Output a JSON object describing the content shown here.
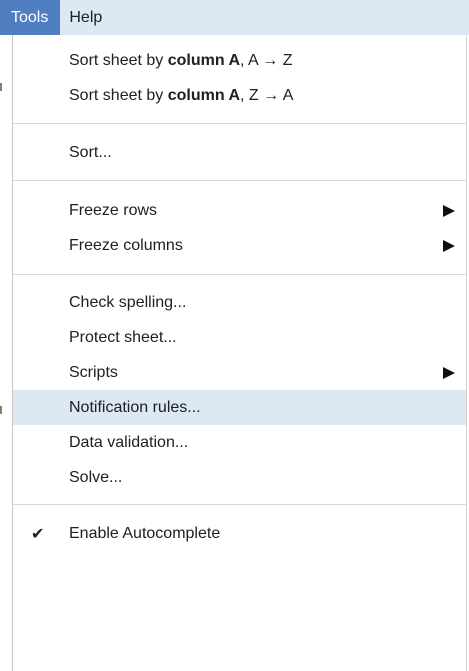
{
  "menubar": {
    "tools_label": "Tools",
    "help_label": "Help"
  },
  "menu": {
    "sort_az": {
      "prefix": "Sort sheet by ",
      "bold": "column A",
      "suffix": ", A → Z"
    },
    "sort_za": {
      "prefix": "Sort sheet by ",
      "bold": "column A",
      "suffix": ", Z → A"
    },
    "sort_label": "Sort...",
    "freeze_rows_label": "Freeze rows",
    "freeze_columns_label": "Freeze columns",
    "check_spelling_label": "Check spelling...",
    "protect_sheet_label": "Protect sheet...",
    "scripts_label": "Scripts",
    "notification_rules_label": "Notification rules...",
    "data_validation_label": "Data validation...",
    "solve_label": "Solve...",
    "enable_autocomplete_label": "Enable Autocomplete",
    "enable_autocomplete_checked": true,
    "highlighted_item": "notification_rules",
    "submenu_icon": "submenu-arrow-icon",
    "check_icon": "checkmark-icon"
  },
  "colors": {
    "active_menu": "#4f7fc0",
    "menubar_bg": "#dde8f5",
    "highlight_bg": "#dde8f5",
    "separator": "#d9d9d9"
  }
}
